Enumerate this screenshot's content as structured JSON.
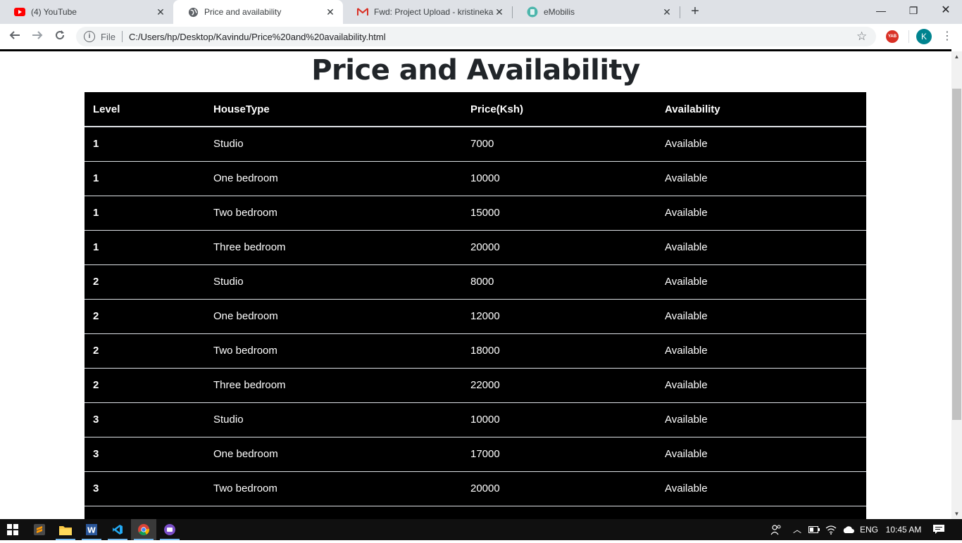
{
  "browser": {
    "tabs": [
      {
        "title": "(4) YouTube",
        "icon": "youtube-icon"
      },
      {
        "title": "Price and availability",
        "icon": "globe-icon"
      },
      {
        "title": "Fwd: Project Upload - kristinekak",
        "icon": "gmail-icon"
      },
      {
        "title": "eMobilis",
        "icon": "emobilis-icon"
      }
    ],
    "address": {
      "scheme": "File",
      "url": "C:/Users/hp/Desktop/Kavindu/Price%20and%20availability.html"
    },
    "profile_initial": "K",
    "extension_label": "YAB"
  },
  "page": {
    "heading": "Price and Availability",
    "table": {
      "headers": [
        "Level",
        "HouseType",
        "Price(Ksh)",
        "Availability"
      ],
      "rows": [
        [
          "1",
          "Studio",
          "7000",
          "Available"
        ],
        [
          "1",
          "One bedroom",
          "10000",
          "Available"
        ],
        [
          "1",
          "Two bedroom",
          "15000",
          "Available"
        ],
        [
          "1",
          "Three bedroom",
          "20000",
          "Available"
        ],
        [
          "2",
          "Studio",
          "8000",
          "Available"
        ],
        [
          "2",
          "One bedroom",
          "12000",
          "Available"
        ],
        [
          "2",
          "Two bedroom",
          "18000",
          "Available"
        ],
        [
          "2",
          "Three bedroom",
          "22000",
          "Available"
        ],
        [
          "3",
          "Studio",
          "10000",
          "Available"
        ],
        [
          "3",
          "One bedroom",
          "17000",
          "Available"
        ],
        [
          "3",
          "Two bedroom",
          "20000",
          "Available"
        ],
        [
          "",
          "",
          "",
          ""
        ]
      ]
    }
  },
  "taskbar": {
    "apps": [
      "sublime-icon",
      "file-explorer-icon",
      "word-icon",
      "vscode-icon",
      "chrome-icon",
      "emulator-icon"
    ],
    "language": "ENG",
    "time": "10:45 AM"
  }
}
